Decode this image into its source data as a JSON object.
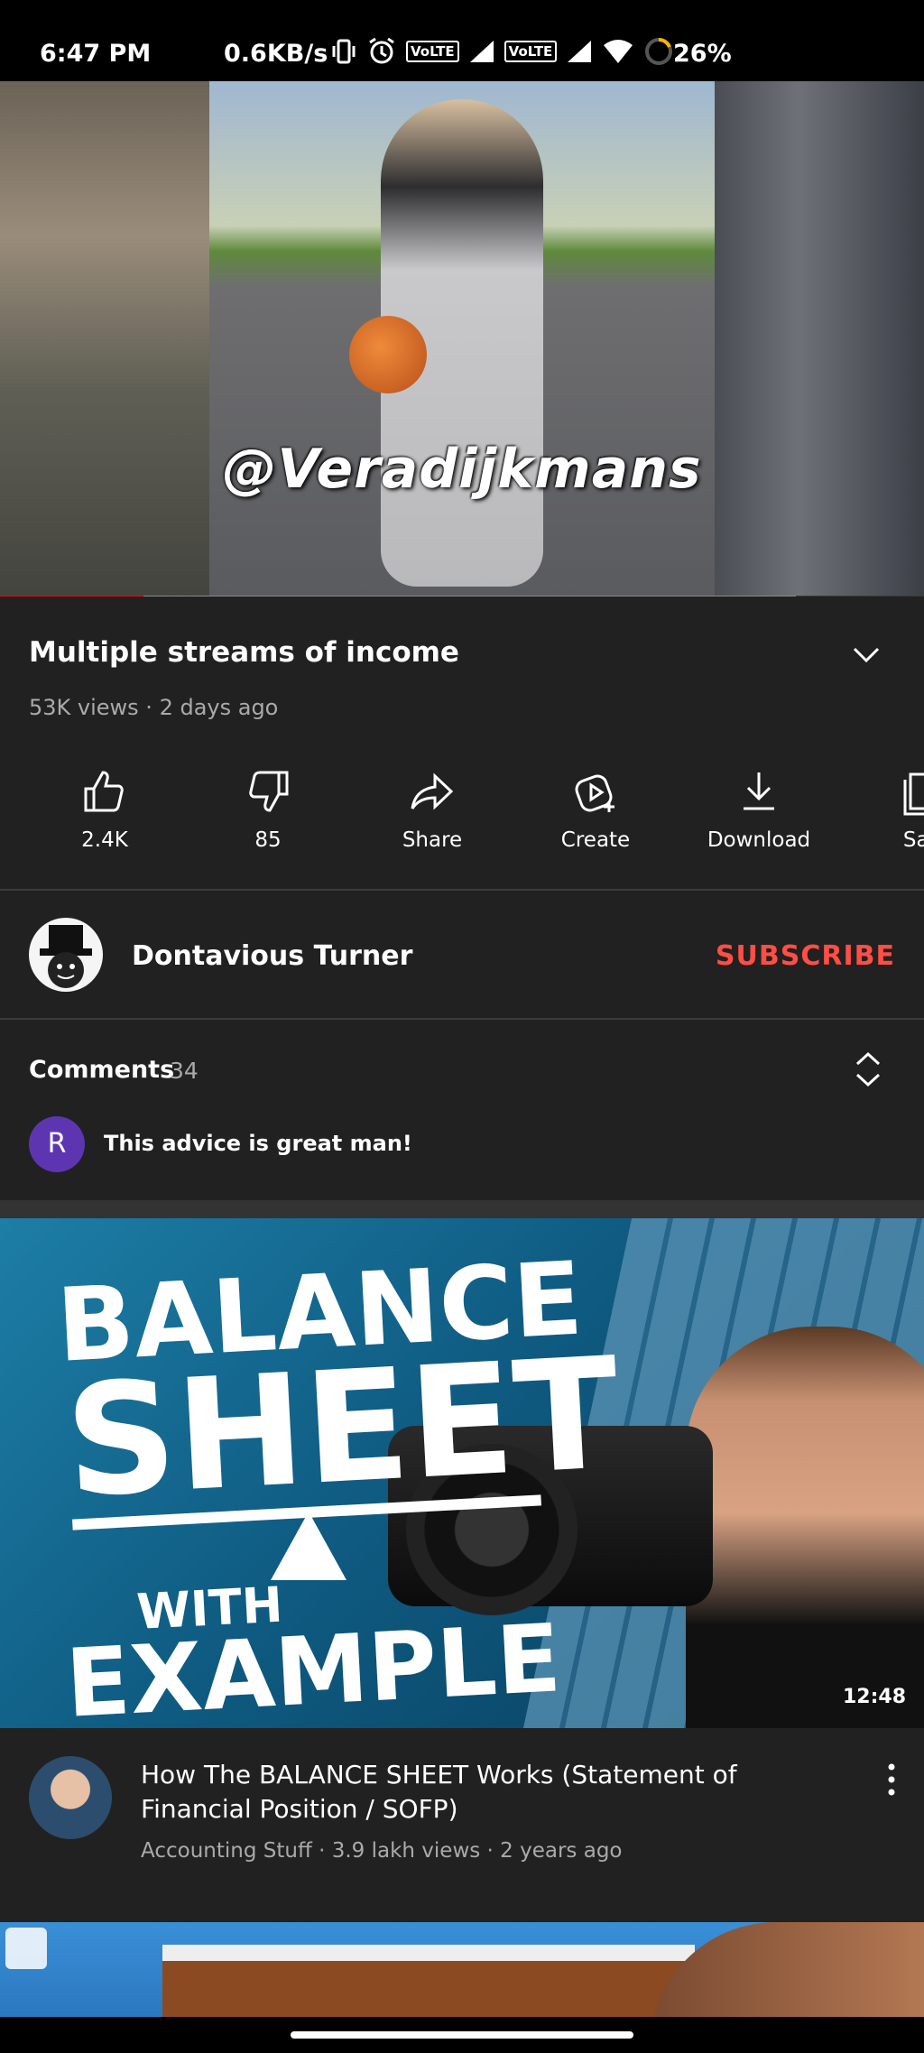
{
  "status_bar": {
    "time": "6:47 PM",
    "network_speed": "0.6KB/s",
    "volte1": "VoLTE",
    "volte2": "VoLTE",
    "battery": "26%"
  },
  "player": {
    "watermark": "@Veradijkmans",
    "progress_played_fraction": 0.155,
    "progress_buffered_fraction": 0.861
  },
  "video": {
    "title": "Multiple streams of income",
    "meta": "53K views · 2 days ago"
  },
  "actions": [
    {
      "label": "2.4K",
      "icon": "like-icon"
    },
    {
      "label": "85",
      "icon": "dislike-icon"
    },
    {
      "label": "Share",
      "icon": "share-icon"
    },
    {
      "label": "Create",
      "icon": "create-icon"
    },
    {
      "label": "Download",
      "icon": "download-icon"
    },
    {
      "label": "Sav",
      "icon": "save-icon"
    }
  ],
  "channel": {
    "name": "Dontavious Turner",
    "subscribe_label": "SUBSCRIBE"
  },
  "comments": {
    "title": "Comments",
    "count": "34",
    "first_avatar_letter": "R",
    "first_comment": "This advice is great man!"
  },
  "recommended": [
    {
      "thumb_text": {
        "line1": "BALANCE",
        "line2": "SHEET",
        "line3": "WITH",
        "line4": "EXAMPLE"
      },
      "duration": "12:48",
      "title": "How The BALANCE SHEET Works (Statement of Financial Position / SOFP)",
      "meta": "Accounting Stuff · 3.9 lakh views · 2 years ago"
    }
  ],
  "colors": {
    "background": "#212121",
    "subscribe": "#ff4e45",
    "progress_played": "#ff0000",
    "comment_avatar": "#5e35b1"
  }
}
